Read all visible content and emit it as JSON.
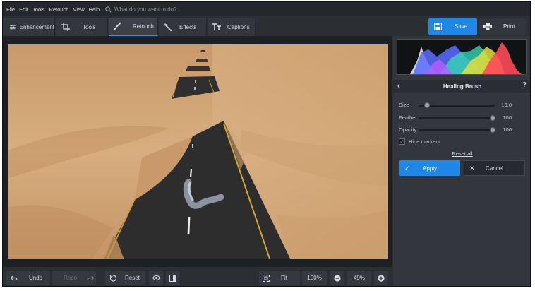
{
  "menu": {
    "items": [
      "File",
      "Edit",
      "Tools",
      "Retouch",
      "View",
      "Help"
    ],
    "search_placeholder": "What do you want to do?"
  },
  "toolbar": {
    "tabs": [
      {
        "label": "Enhancement",
        "icon": "sliders-icon"
      },
      {
        "label": "Tools",
        "icon": "crop-icon"
      },
      {
        "label": "Retouch",
        "icon": "brush-icon",
        "active": true
      },
      {
        "label": "Effects",
        "icon": "magic-wand-icon"
      },
      {
        "label": "Captions",
        "icon": "text-icon"
      }
    ],
    "save_label": "Save",
    "print_label": "Print"
  },
  "panel": {
    "title": "Healing Brush",
    "sliders": [
      {
        "label": "Size",
        "value": "13.0",
        "fraction": 0.11
      },
      {
        "label": "Feather",
        "value": "100",
        "fraction": 1.0
      },
      {
        "label": "Opacity",
        "value": "100",
        "fraction": 1.0
      }
    ],
    "hide_markers_label": "Hide markers",
    "hide_markers_checked": true,
    "reset_all_label": "Reset all",
    "apply_label": "Apply",
    "cancel_label": "Cancel"
  },
  "bottom": {
    "undo_label": "Undo",
    "redo_label": "Redo",
    "reset_label": "Reset",
    "fit_label": "Fit",
    "zoom_100_label": "100%",
    "zoom_value": "49%"
  },
  "colors": {
    "accent": "#1f87e5",
    "panel_bg": "#33363c",
    "sand": "#d2a676",
    "asphalt": "#2e2d2d"
  }
}
